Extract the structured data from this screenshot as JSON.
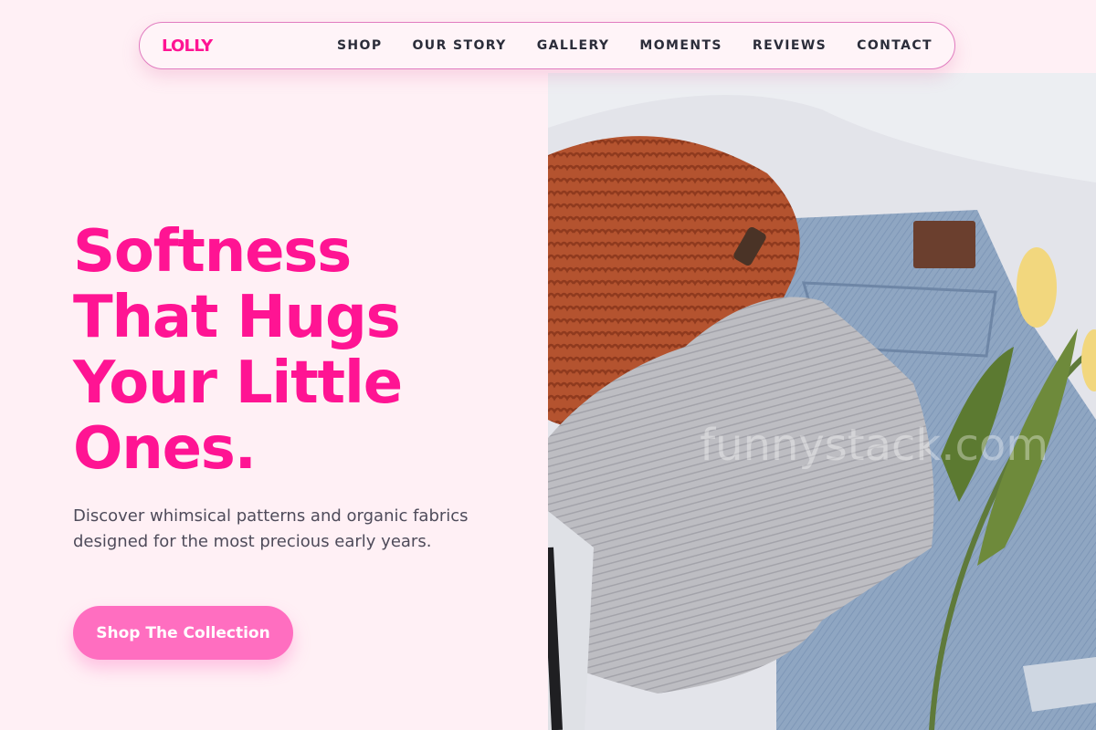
{
  "brand": {
    "logo": "LOLLY",
    "accent_color": "#ff1493"
  },
  "nav": {
    "items": [
      {
        "label": "SHOP"
      },
      {
        "label": "OUR STORY"
      },
      {
        "label": "GALLERY"
      },
      {
        "label": "MOMENTS"
      },
      {
        "label": "REVIEWS"
      },
      {
        "label": "CONTACT"
      }
    ]
  },
  "hero": {
    "headline_lines": [
      "Softness",
      "That Hugs",
      "Your Little",
      "Ones."
    ],
    "description": "Discover whimsical patterns and organic fabrics designed for the most precious early years.",
    "cta_label": "Shop The Collection",
    "cta_color": "#ff6ec0"
  },
  "image": {
    "watermark": "funnystack.com"
  }
}
